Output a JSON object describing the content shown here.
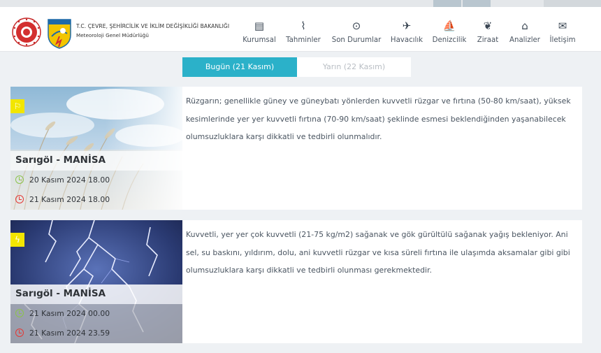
{
  "header": {
    "ministry": "T.C. ÇEVRE, ŞEHİRCİLİK VE İKLİM DEĞİŞİKLİĞİ BAKANLIĞI",
    "subtitle": "Meteoroloji Genel Müdürlüğü",
    "logo_text": "METEOROLOJİ"
  },
  "nav": [
    {
      "label": "Kurumsal",
      "icon": "document-icon",
      "glyph": "▤"
    },
    {
      "label": "Tahminler",
      "icon": "chart-icon",
      "glyph": "⌇"
    },
    {
      "label": "Son Durumlar",
      "icon": "check-circle-icon",
      "glyph": "⊙"
    },
    {
      "label": "Havacılık",
      "icon": "plane-icon",
      "glyph": "✈"
    },
    {
      "label": "Denizcilik",
      "icon": "sailboat-icon",
      "glyph": "⛵"
    },
    {
      "label": "Ziraat",
      "icon": "leaf-icon",
      "glyph": "❦"
    },
    {
      "label": "Analizler",
      "icon": "home-drop-icon",
      "glyph": "⌂"
    },
    {
      "label": "İletişim",
      "icon": "envelope-icon",
      "glyph": "✉"
    }
  ],
  "tabs": {
    "today": "Bugün (21 Kasım)",
    "tomorrow": "Yarın (22 Kasım)"
  },
  "warnings": [
    {
      "icon": "wind-flag-icon",
      "location": "Sarıgöl - MANİSA",
      "start": "20 Kasım 2024 18.00",
      "end": "21 Kasım 2024 18.00",
      "text": "Rüzgarın; genellikle güney ve güneybatı yönlerden kuvvetli rüzgar ve fırtına (50-80 km/saat), yüksek kesimlerinde yer yer kuvvetli fırtına (70-90 km/saat) şeklinde esmesi beklendiğinden yaşanabilecek olumsuzluklara karşı dikkatli ve tedbirli olunmalıdır."
    },
    {
      "icon": "lightning-icon",
      "location": "Sarıgöl - MANİSA",
      "start": "21 Kasım 2024 00.00",
      "end": "21 Kasım 2024 23.59",
      "text": "Kuvvetli, yer yer çok kuvvetli (21-75 kg/m2) sağanak ve gök gürültülü sağanak yağış bekleniyor. Ani sel, su baskını, yıldırım, dolu, ani kuvvetli rüzgar ve kısa süreli fırtına ile ulaşımda aksamalar gibi gibi olumsuzluklara karşı dikkatli ve tedbirli olunması gerekmektedir."
    }
  ],
  "colors": {
    "accent": "#2bb1c9",
    "badge": "#f2e600",
    "start_clock": "#8bc34a",
    "end_clock": "#e53935"
  }
}
